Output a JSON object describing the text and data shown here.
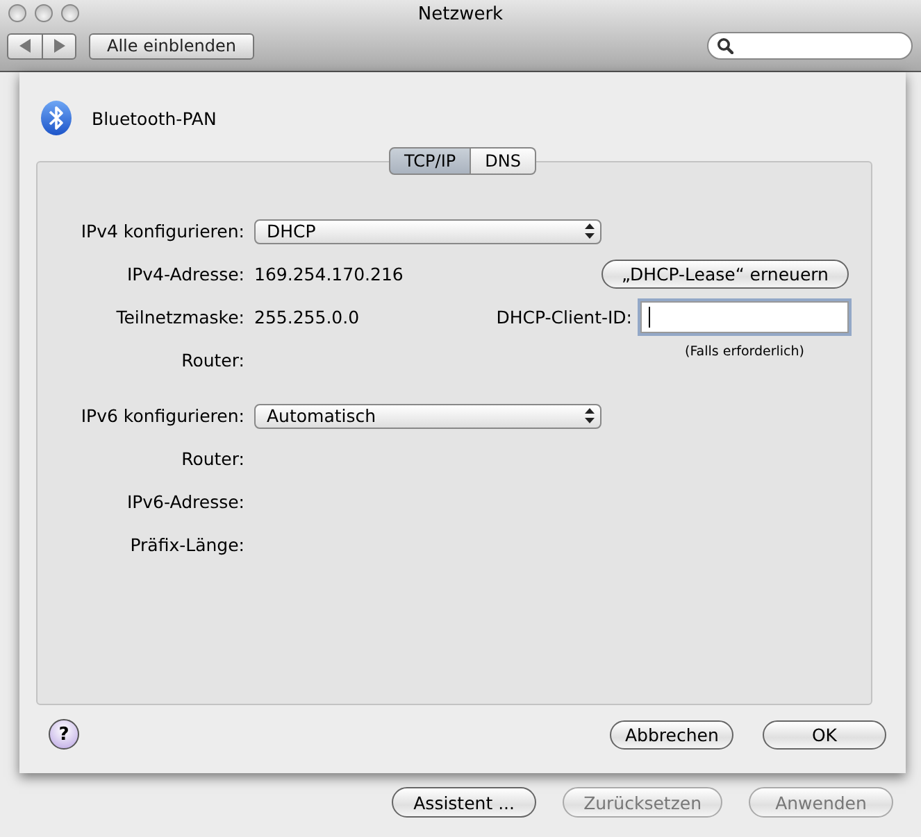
{
  "window": {
    "title": "Netzwerk"
  },
  "toolbar": {
    "show_all": "Alle einblenden"
  },
  "sheet": {
    "service": "Bluetooth-PAN",
    "tabs": [
      {
        "label": "TCP/IP",
        "selected": true
      },
      {
        "label": "DNS",
        "selected": false
      }
    ],
    "rows": [
      {
        "kind": "popup",
        "label": "IPv4 konfigurieren:",
        "value": "DHCP"
      },
      {
        "kind": "text",
        "label": "IPv4-Adresse:",
        "value": "169.254.170.216",
        "side": {
          "kind": "button",
          "label": "„DHCP-Lease“ erneuern"
        }
      },
      {
        "kind": "text",
        "label": "Teilnetzmaske:",
        "value": "255.255.0.0",
        "side": {
          "kind": "field",
          "label": "DHCP-Client-ID:",
          "focused": true
        }
      },
      {
        "kind": "text",
        "label": "Router:",
        "side": {
          "kind": "hint",
          "text": "(Falls erforderlich)"
        }
      },
      {
        "kind": "popup",
        "label": "IPv6 konfigurieren:",
        "value": "Automatisch"
      },
      {
        "kind": "text",
        "label": "Router:"
      },
      {
        "kind": "text",
        "label": "IPv6-Adresse:"
      },
      {
        "kind": "text",
        "label": "Präfix-Länge:"
      }
    ],
    "help": "?",
    "buttons": [
      {
        "label": "Abbrechen",
        "default": false
      },
      {
        "label": "OK",
        "default": false
      }
    ]
  },
  "bottom_buttons": [
    {
      "label": "Assistent ...",
      "disabled": false
    },
    {
      "label": "Zurücksetzen",
      "disabled": true
    },
    {
      "label": "Anwenden",
      "disabled": true
    }
  ]
}
